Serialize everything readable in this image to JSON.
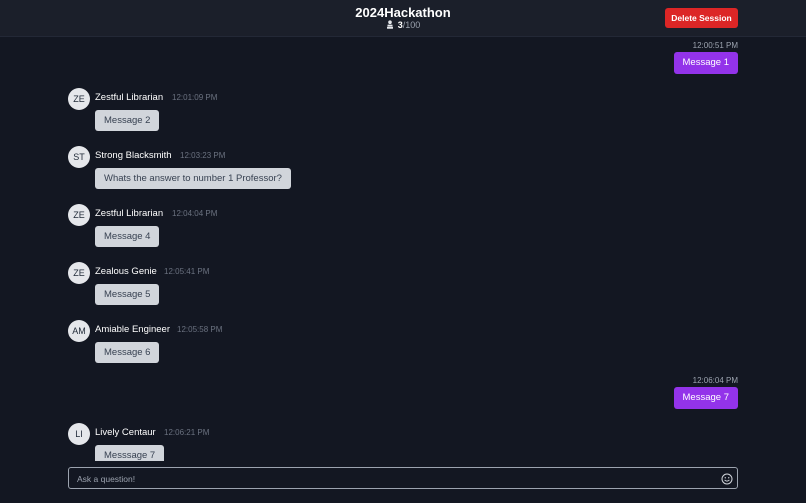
{
  "header": {
    "title": "2024Hackathon",
    "participants_current": "3",
    "participants_max": "/100",
    "delete_label": "Delete Session"
  },
  "messages": [
    {
      "own": true,
      "time": "12:00:51 PM",
      "text": "Message 1"
    },
    {
      "own": false,
      "initials": "ZE",
      "author": "Zestful Librarian",
      "time": "12:01:09 PM",
      "text": "Message 2"
    },
    {
      "own": false,
      "initials": "ST",
      "author": "Strong Blacksmith",
      "time": "12:03:23 PM",
      "text": "Whats the answer to number 1 Professor?"
    },
    {
      "own": false,
      "initials": "ZE",
      "author": "Zestful Librarian",
      "time": "12:04:04 PM",
      "text": "Message 4"
    },
    {
      "own": false,
      "initials": "ZE",
      "author": "Zealous Genie",
      "time": "12:05:41 PM",
      "text": "Message 5"
    },
    {
      "own": false,
      "initials": "AM",
      "author": "Amiable Engineer",
      "time": "12:05:58 PM",
      "text": "Message 6"
    },
    {
      "own": true,
      "time": "12:06:04 PM",
      "text": "Message 7"
    },
    {
      "own": false,
      "initials": "LI",
      "author": "Lively Centaur",
      "time": "12:06:21 PM",
      "text": "Messsage 7"
    }
  ],
  "composer": {
    "placeholder": "Ask a question!",
    "emoji_icon": "smiley-face-icon"
  },
  "colors": {
    "background": "#131722",
    "own_bubble": "#9333ea",
    "other_bubble": "#d1d5db",
    "delete_button": "#dc2626"
  }
}
